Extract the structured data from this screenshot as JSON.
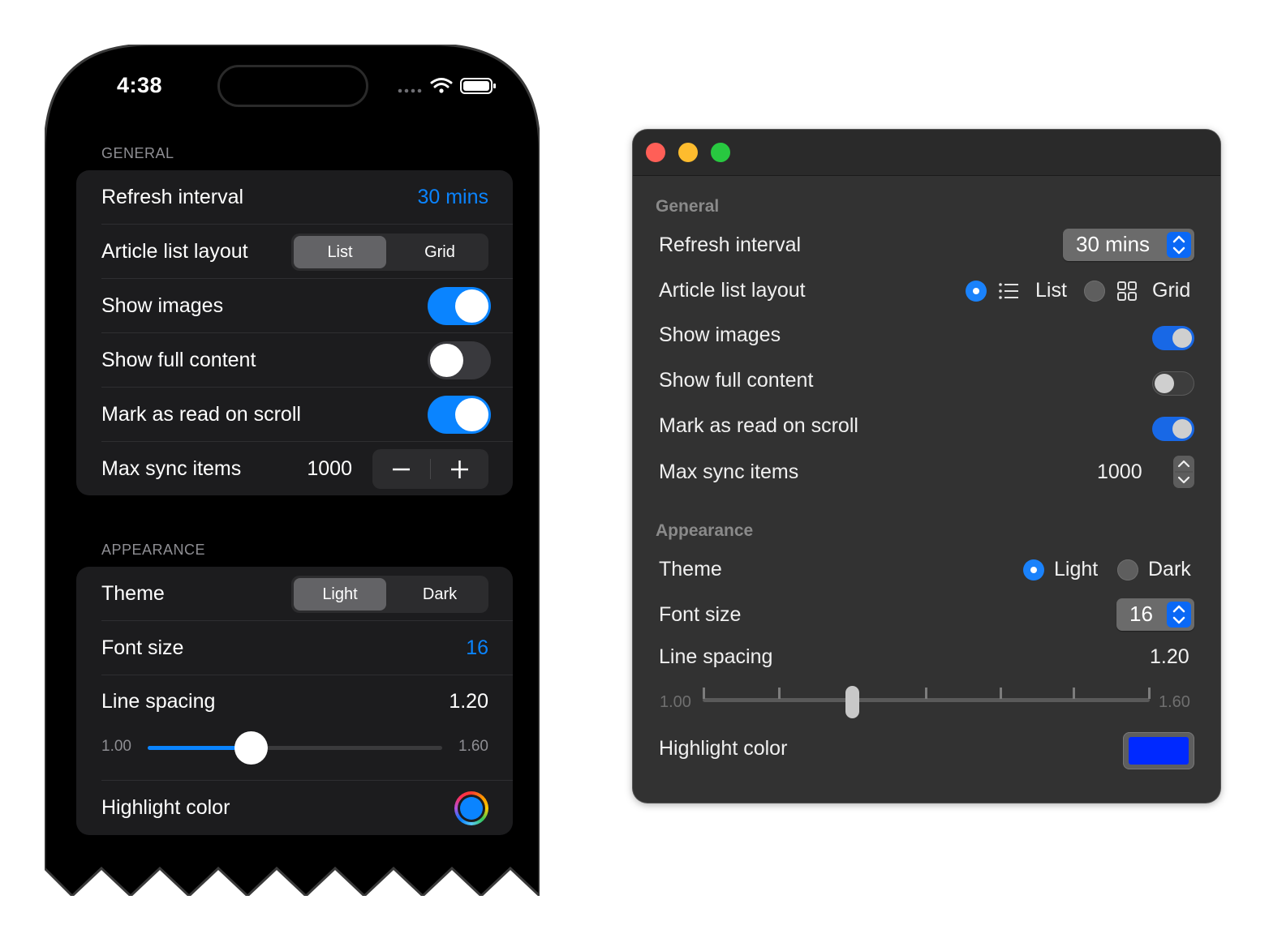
{
  "ios": {
    "status_time": "4:38",
    "general_title": "GENERAL",
    "refresh_label": "Refresh interval",
    "refresh_value": "30 mins",
    "layout_label": "Article list layout",
    "layout_options": [
      "List",
      "Grid"
    ],
    "layout_selected": "List",
    "show_images_label": "Show images",
    "show_images_on": true,
    "show_full_label": "Show full content",
    "show_full_on": false,
    "mark_read_label": "Mark as read on scroll",
    "mark_read_on": true,
    "max_sync_label": "Max sync items",
    "max_sync_value": "1000",
    "appearance_title": "APPEARANCE",
    "theme_label": "Theme",
    "theme_options": [
      "Light",
      "Dark"
    ],
    "theme_selected": "Light",
    "font_size_label": "Font size",
    "font_size_value": "16",
    "line_spacing_label": "Line spacing",
    "line_spacing_value": "1.20",
    "slider_min": "1.00",
    "slider_max": "1.60",
    "slider_fraction": 0.35,
    "highlight_label": "Highlight color",
    "highlight_color": "#0a84ff"
  },
  "mac": {
    "general_title": "General",
    "refresh_label": "Refresh interval",
    "refresh_value": "30 mins",
    "layout_label": "Article list layout",
    "layout_options": [
      "List",
      "Grid"
    ],
    "layout_selected": "List",
    "show_images_label": "Show images",
    "show_images_on": true,
    "show_full_label": "Show full content",
    "show_full_on": false,
    "mark_read_label": "Mark as read on scroll",
    "mark_read_on": true,
    "max_sync_label": "Max sync items",
    "max_sync_value": "1000",
    "appearance_title": "Appearance",
    "theme_label": "Theme",
    "theme_options": [
      "Light",
      "Dark"
    ],
    "theme_selected": "Light",
    "font_size_label": "Font size",
    "font_size_value": "16",
    "line_spacing_label": "Line spacing",
    "line_spacing_value": "1.20",
    "slider_min": "1.00",
    "slider_max": "1.60",
    "slider_fraction": 0.33,
    "highlight_label": "Highlight color",
    "highlight_color": "#0029ff",
    "traffic_lights": [
      "#ff5f57",
      "#febc2e",
      "#28c840"
    ]
  }
}
